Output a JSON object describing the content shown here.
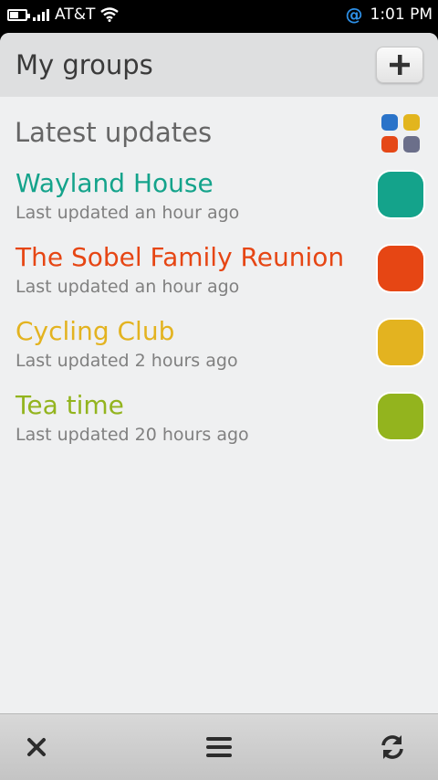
{
  "status": {
    "carrier": "AT&T",
    "time": "1:01 PM",
    "notification_icon": "@"
  },
  "header": {
    "title": "My groups",
    "add_icon": "plus-icon"
  },
  "section": {
    "title": "Latest updates",
    "icon": "apps-grid-icon",
    "icon_colors": [
      "#2a73c9",
      "#e2b51e",
      "#e54817",
      "#6b6f8a"
    ]
  },
  "groups": [
    {
      "name": "Wayland House",
      "updated": "Last updated an hour ago",
      "color": "#14a38b"
    },
    {
      "name": "The Sobel Family Reunion",
      "updated": "Last updated an hour ago",
      "color": "#e64614"
    },
    {
      "name": "Cycling Club",
      "updated": "Last updated 2 hours ago",
      "color": "#e3b320"
    },
    {
      "name": "Tea time",
      "updated": "Last updated 20 hours ago",
      "color": "#93b41e"
    }
  ],
  "toolbar": {
    "close_icon": "close-icon",
    "menu_icon": "menu-icon",
    "refresh_icon": "refresh-icon"
  }
}
